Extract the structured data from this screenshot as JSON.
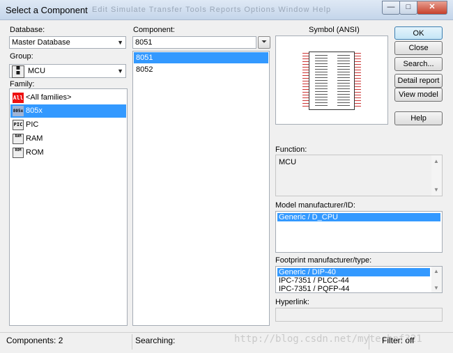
{
  "window": {
    "title": "Select a Component",
    "ghost_menu": "Edit  Simulate  Transfer  Tools  Reports  Options  Window  Help"
  },
  "window_controls": {
    "minimize": "—",
    "maximize": "□",
    "close": "✕"
  },
  "database": {
    "label": "Database:",
    "value": "Master Database"
  },
  "group": {
    "label": "Group:",
    "value": "MCU"
  },
  "family": {
    "label": "Family:",
    "items": [
      {
        "label": "<All families>",
        "icon": "All"
      },
      {
        "label": "805x",
        "icon": "805x"
      },
      {
        "label": "PIC",
        "icon": "PIC"
      },
      {
        "label": "RAM",
        "icon": "RAM"
      },
      {
        "label": "ROM",
        "icon": "ROM"
      }
    ],
    "selected_index": 1
  },
  "component": {
    "label": "Component:",
    "search_value": "8051",
    "items": [
      "8051",
      "8052"
    ],
    "selected_index": 0
  },
  "symbol": {
    "label": "Symbol (ANSI)"
  },
  "buttons": {
    "ok": "OK",
    "close": "Close",
    "search": "Search...",
    "detail_report": "Detail report",
    "view_model": "View model",
    "help": "Help"
  },
  "function": {
    "label": "Function:",
    "value": "MCU"
  },
  "model_manufacturer": {
    "label": "Model manufacturer/ID:",
    "items": [
      "Generic / D_CPU"
    ]
  },
  "footprint": {
    "label": "Footprint manufacturer/type:",
    "items": [
      "Generic / DIP-40",
      "IPC-7351 / PLCC-44",
      "IPC-7351 / PQFP-44"
    ]
  },
  "hyperlink": {
    "label": "Hyperlink:",
    "value": ""
  },
  "status": {
    "components": "Components: 2",
    "searching": "Searching:",
    "filter": "Filter: off"
  },
  "watermark": "http://blog.csdn.net/mytechnf321",
  "colors": {
    "selection": "#3399ff",
    "titlebar": "#c4d5ea",
    "pin": "#cc3333"
  }
}
